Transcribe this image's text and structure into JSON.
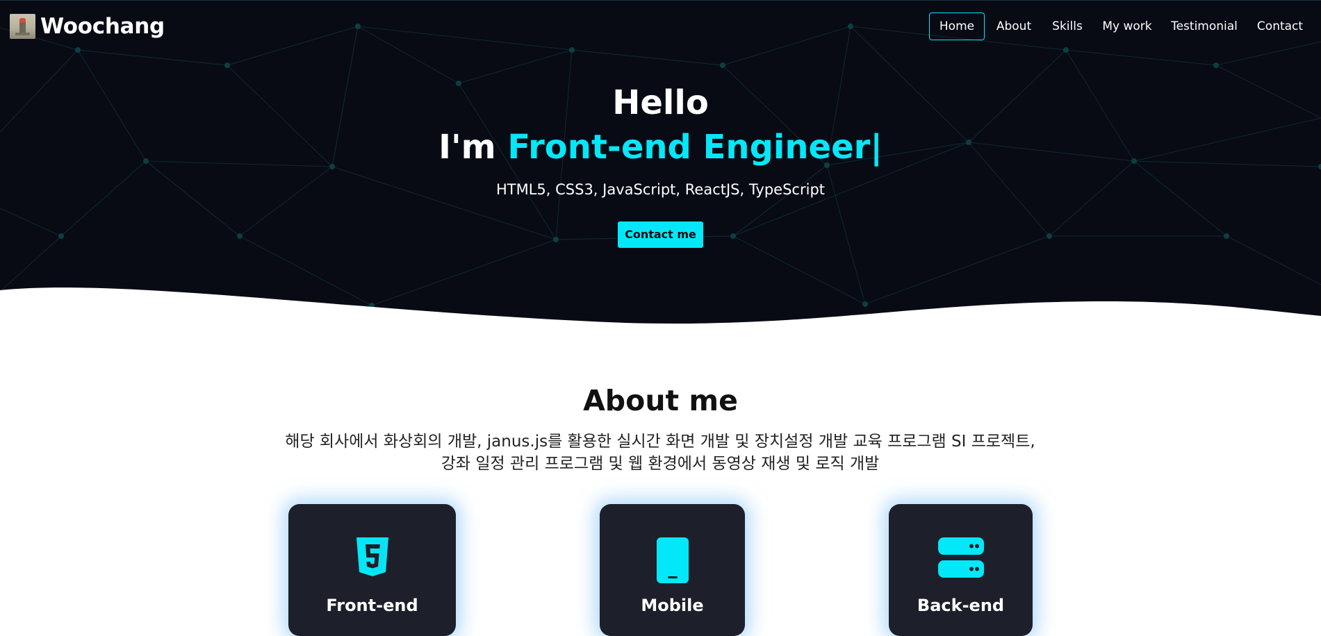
{
  "brand": {
    "name": "Woochang",
    "accent_color": "#03e8f9",
    "dark_bg": "#080b14",
    "card_bg": "#1d202a"
  },
  "nav": {
    "items": [
      {
        "label": "Home",
        "active": true
      },
      {
        "label": "About",
        "active": false
      },
      {
        "label": "Skills",
        "active": false
      },
      {
        "label": "My work",
        "active": false
      },
      {
        "label": "Testimonial",
        "active": false
      },
      {
        "label": "Contact",
        "active": false
      }
    ]
  },
  "hero": {
    "greeting": "Hello",
    "role_prefix": "I'm ",
    "role": "Front-end Engineer|",
    "skills": "HTML5, CSS3, JavaScript, ReactJS, TypeScript",
    "cta_label": "Contact me"
  },
  "about": {
    "title": "About me",
    "description": "해당 회사에서 화상회의 개발, janus.js를 활용한 실시간 화면 개발 및 장치설정 개발 교육 프로그램 SI 프로젝트, 강좌 일정 관리 프로그램 및 웹 환경에서 동영상 재생 및 로직 개발",
    "cards": [
      {
        "title": "Front-end",
        "icon": "html5-icon"
      },
      {
        "title": "Mobile",
        "icon": "mobile-phone-icon"
      },
      {
        "title": "Back-end",
        "icon": "server-icon"
      }
    ]
  }
}
